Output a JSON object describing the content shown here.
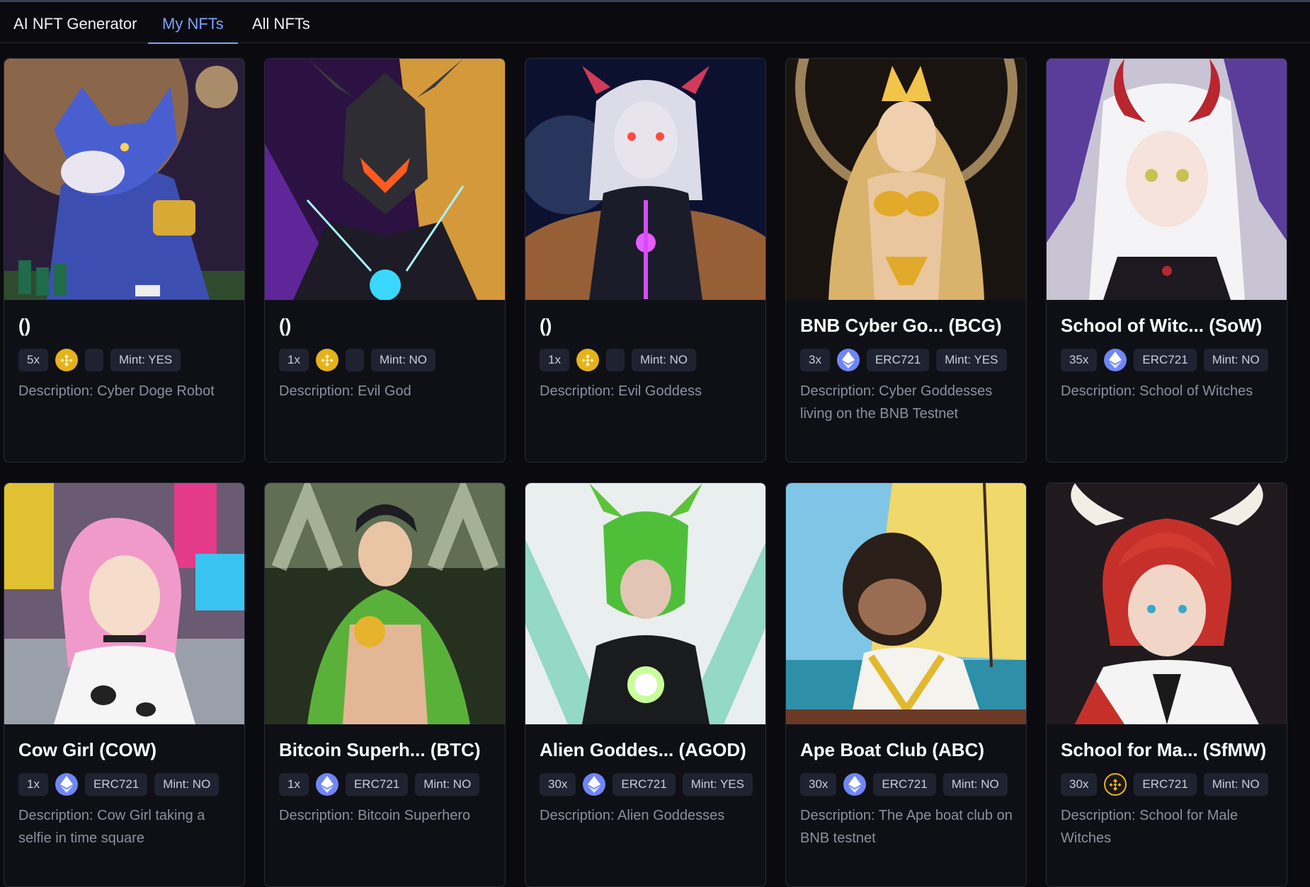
{
  "tabs": [
    {
      "label": "AI NFT Generator"
    },
    {
      "label": "My NFTs"
    },
    {
      "label": "All NFTs"
    }
  ],
  "active_tab": "My NFTs",
  "colors": {
    "accent": "#7ea2ff",
    "bnb": "#e5b21b",
    "eth": "#6f86f5",
    "background": "#0b0b0f"
  },
  "cards": [
    {
      "title": "()",
      "count": "5x",
      "coin_icon": "bnb-coin-icon",
      "standard": "",
      "mint": "Mint: YES",
      "description": "Description: Cyber Doge Robot",
      "image": "cyber-doge-robot-art"
    },
    {
      "title": "()",
      "count": "1x",
      "coin_icon": "bnb-coin-icon",
      "standard": "",
      "mint": "Mint: NO",
      "description": "Description: Evil God",
      "image": "evil-god-art"
    },
    {
      "title": "()",
      "count": "1x",
      "coin_icon": "bnb-coin-icon",
      "standard": "",
      "mint": "Mint: NO",
      "description": "Description: Evil Goddess",
      "image": "evil-goddess-art"
    },
    {
      "title": "BNB Cyber Go...   (BCG)",
      "count": "3x",
      "coin_icon": "eth-coin-icon",
      "standard": "ERC721",
      "mint": "Mint: YES",
      "description": "Description: Cyber Goddesses living on the BNB Testnet",
      "image": "cyber-goddess-art"
    },
    {
      "title": "School of Witc...   (SoW)",
      "count": "35x",
      "coin_icon": "eth-coin-icon",
      "standard": "ERC721",
      "mint": "Mint: NO",
      "description": "Description: School of Witches",
      "image": "witch-art"
    },
    {
      "title": "Cow Girl (COW)",
      "count": "1x",
      "coin_icon": "eth-coin-icon",
      "standard": "ERC721",
      "mint": "Mint: NO",
      "description": "Description: Cow Girl taking a selfie in time square",
      "image": "cow-girl-art"
    },
    {
      "title": "Bitcoin Superh...   (BTC)",
      "count": "1x",
      "coin_icon": "eth-coin-icon",
      "standard": "ERC721",
      "mint": "Mint: NO",
      "description": "Description: Bitcoin Superhero",
      "image": "bitcoin-superhero-art"
    },
    {
      "title": "Alien Goddes...   (AGOD)",
      "count": "30x",
      "coin_icon": "eth-coin-icon",
      "standard": "ERC721",
      "mint": "Mint: YES",
      "description": "Description: Alien Goddesses",
      "image": "alien-goddess-art"
    },
    {
      "title": "Ape Boat Club (ABC)",
      "count": "30x",
      "coin_icon": "eth-coin-icon",
      "standard": "ERC721",
      "mint": "Mint: NO",
      "description": "Description: The Ape boat club on BNB testnet",
      "image": "ape-boat-art"
    },
    {
      "title": "School for Ma...   (SfMW)",
      "count": "30x",
      "coin_icon": "bnb-dark-coin-icon",
      "standard": "ERC721",
      "mint": "Mint: NO",
      "description": "Description: School for Male Witches",
      "image": "male-witch-art"
    }
  ]
}
